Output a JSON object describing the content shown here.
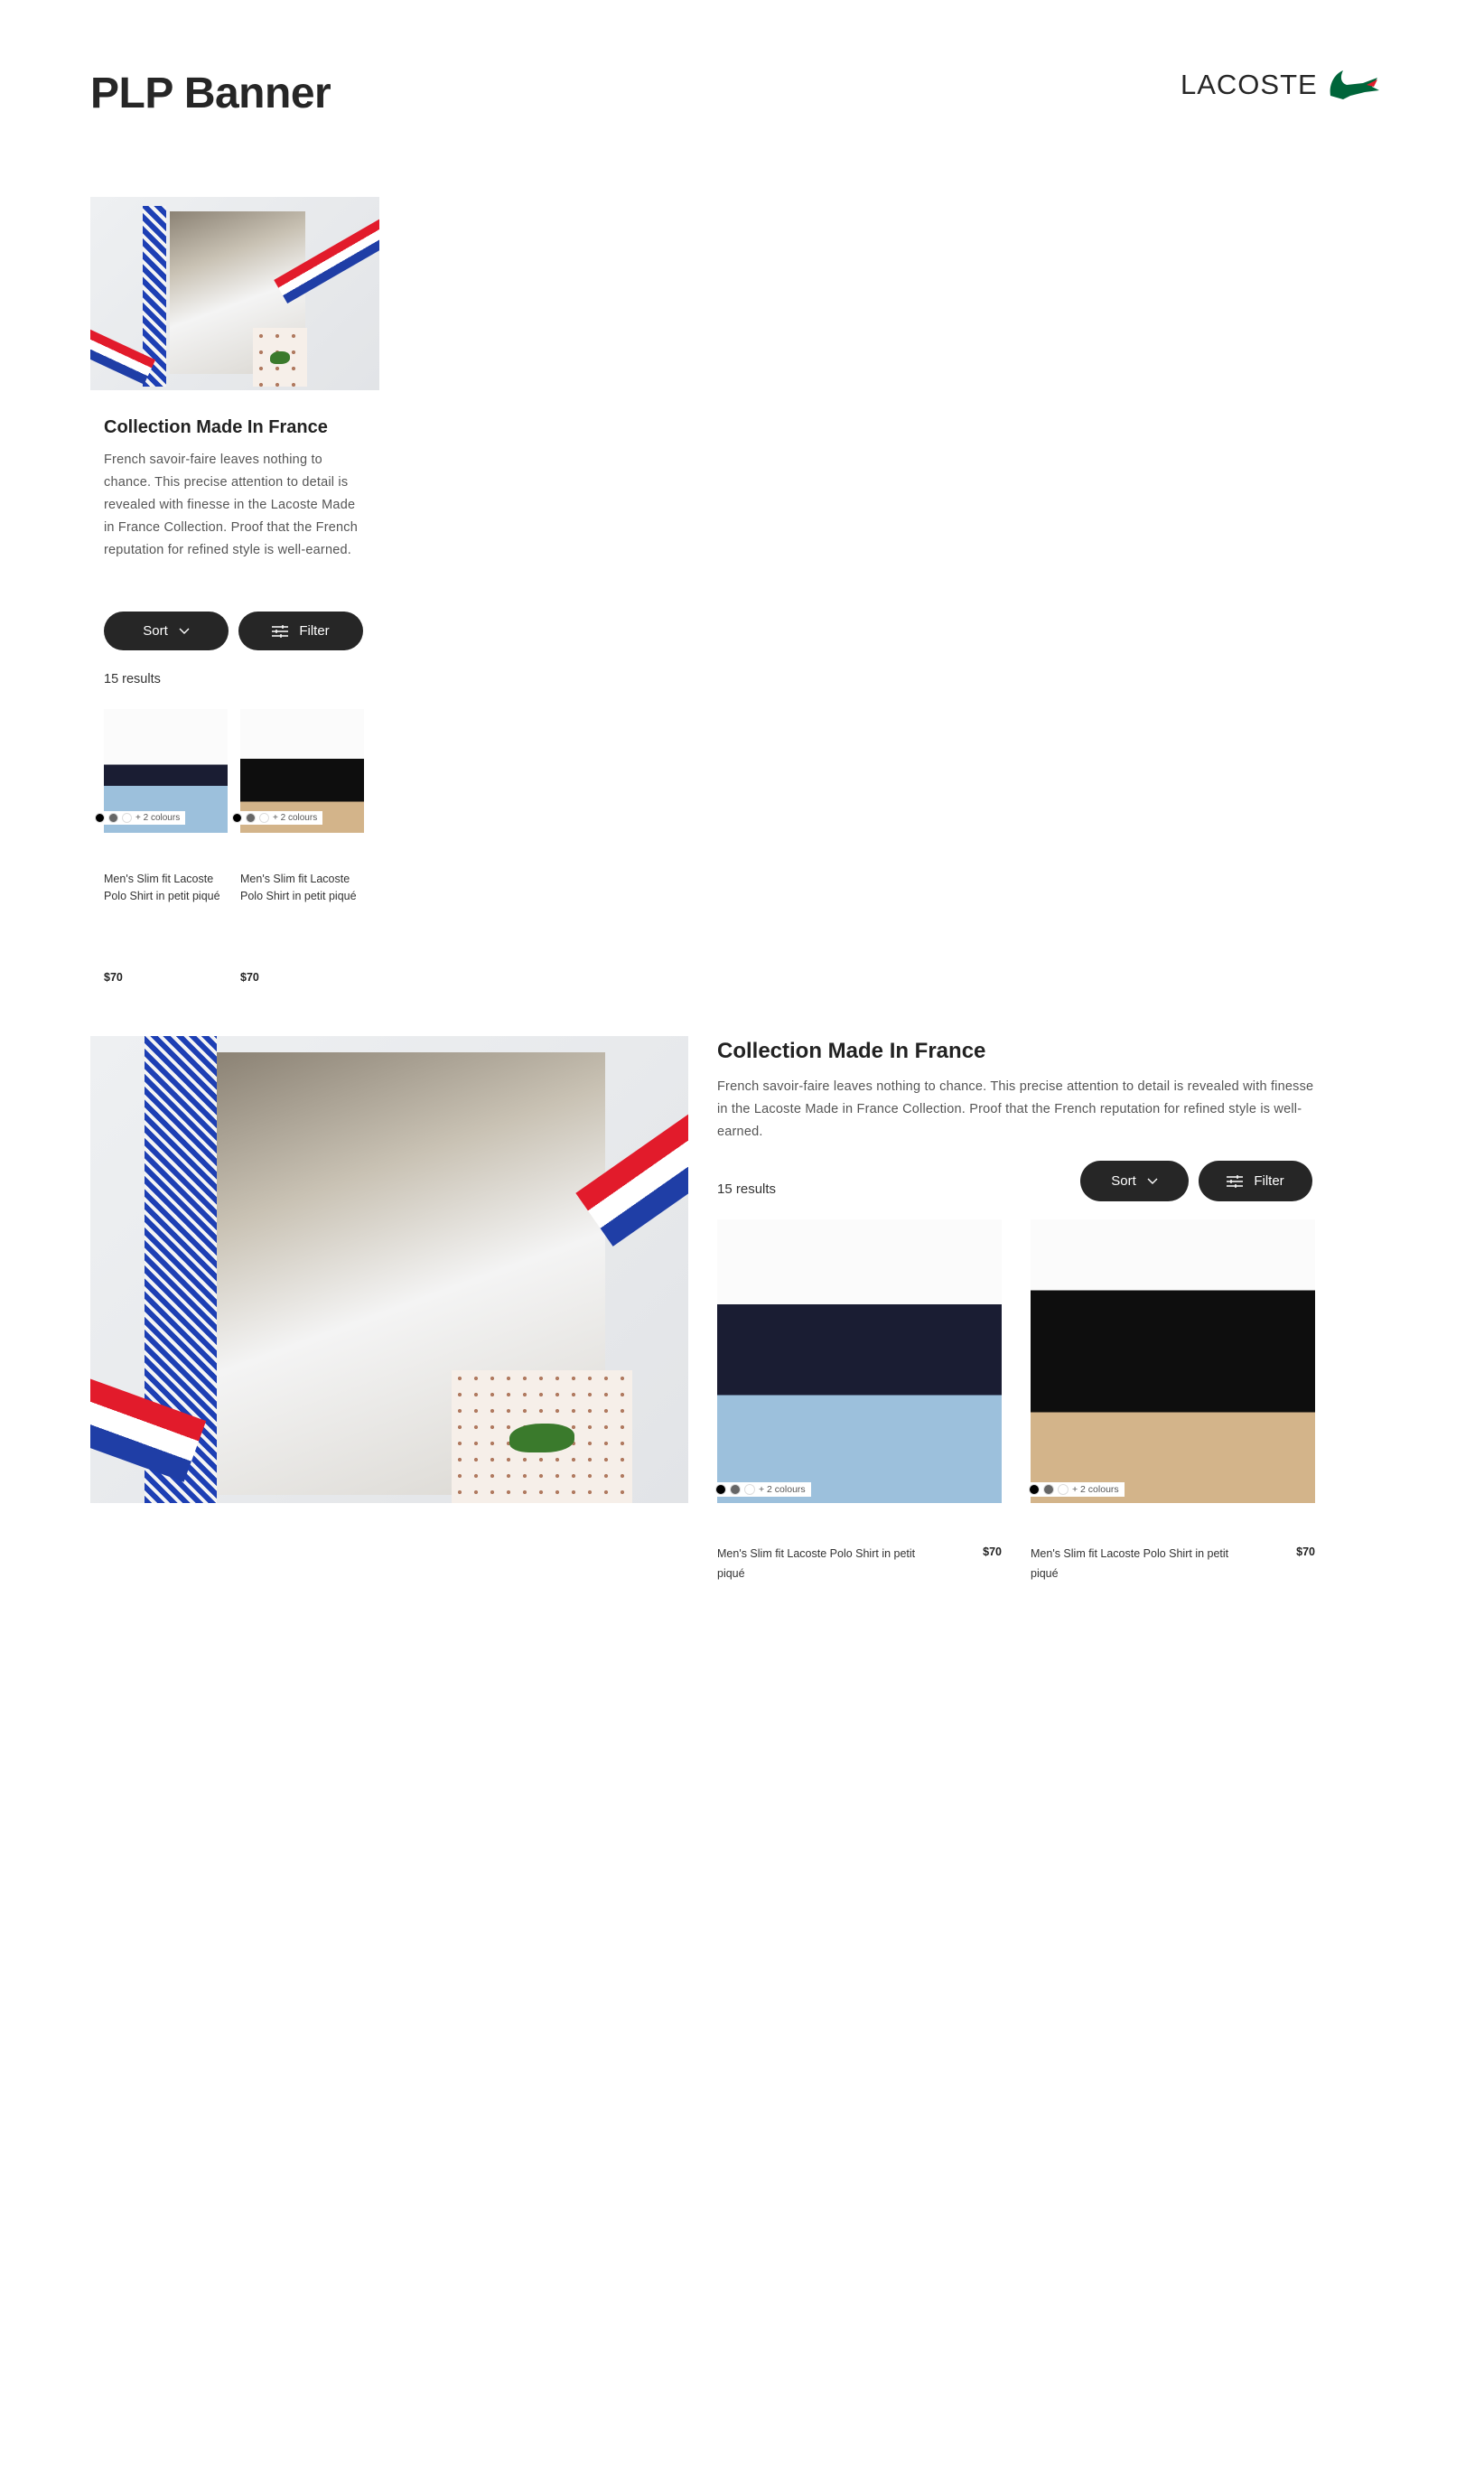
{
  "page": {
    "title": "PLP Banner"
  },
  "brand": {
    "name": "LACOSTE",
    "logo_icon": "crocodile-icon",
    "color": "#00653a"
  },
  "collection": {
    "heading": "Collection Made In France",
    "description": "French savoir-faire leaves nothing to chance. This precise attention to detail is revealed with finesse in the Lacoste Made in France Collection. Proof that the French reputation for refined style is well-earned.",
    "results": "15 results",
    "sort_label": "Sort",
    "filter_label": "Filter"
  },
  "products": [
    {
      "name": "Men's Slim fit Lacoste Polo Shirt in petit piqué",
      "price": "$70",
      "more_colours": "+ 2 colours",
      "swatches": [
        "#000000",
        "#666666",
        "#ffffff"
      ]
    },
    {
      "name": "Men's Slim fit Lacoste Polo Shirt in petit piqué",
      "price": "$70",
      "more_colours": "+ 2 colours",
      "swatches": [
        "#000000",
        "#666666",
        "#ffffff"
      ]
    }
  ],
  "colors": {
    "button": "#262626",
    "text": "#222222",
    "muted": "#555555"
  }
}
